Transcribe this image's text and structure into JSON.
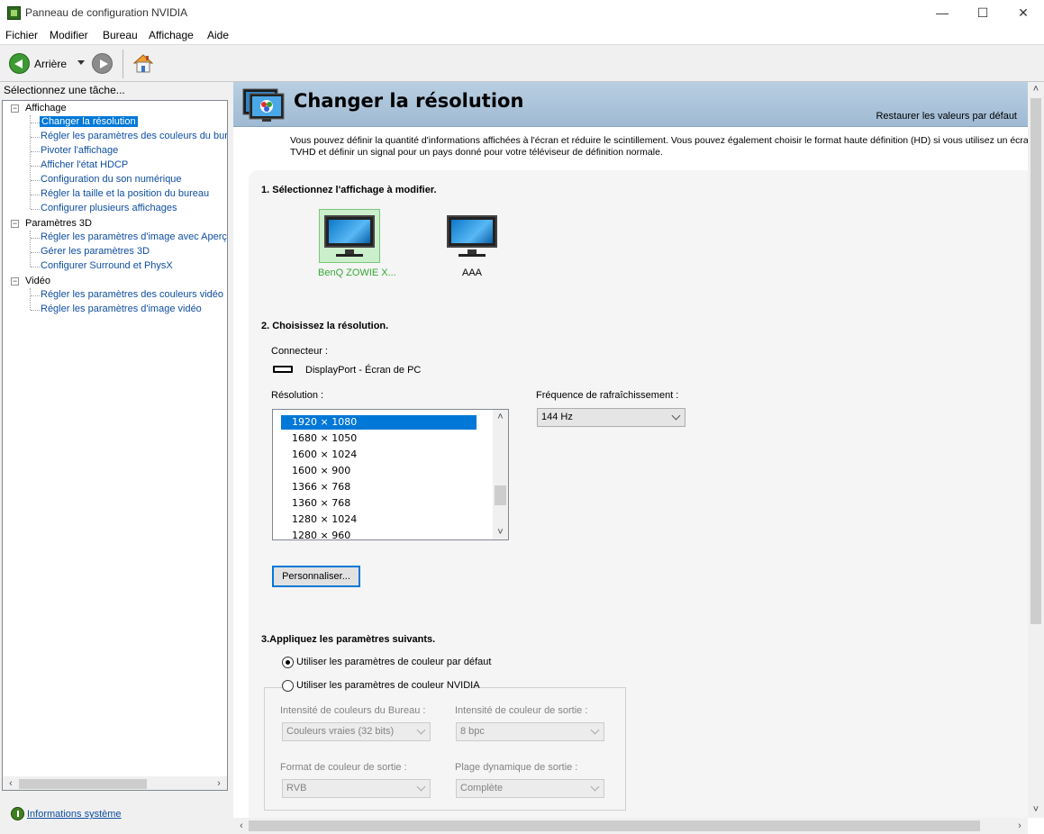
{
  "window": {
    "title": "Panneau de configuration NVIDIA",
    "minimize": "—",
    "maximize": "☐",
    "close": "✕"
  },
  "menu": [
    "Fichier",
    "Modifier",
    "Bureau",
    "Affichage",
    "Aide"
  ],
  "toolbar": {
    "back_label": "Arrière"
  },
  "sidebar": {
    "header": "Sélectionnez une tâche...",
    "groups": [
      {
        "label": "Affichage",
        "expander": "−",
        "items": [
          "Changer la résolution",
          "Régler les paramètres des couleurs du bure",
          "Pivoter l'affichage",
          "Afficher l'état HDCP",
          "Configuration du son numérique",
          "Régler la taille et la position du bureau",
          "Configurer plusieurs affichages"
        ]
      },
      {
        "label": "Paramètres 3D",
        "expander": "−",
        "items": [
          "Régler les paramètres d'image avec Aperçu",
          "Gérer les paramètres 3D",
          "Configurer Surround et PhysX"
        ]
      },
      {
        "label": "Vidéo",
        "expander": "−",
        "items": [
          "Régler les paramètres des couleurs vidéo",
          "Régler les paramètres d'image vidéo"
        ]
      }
    ],
    "selected_item": "Changer la résolution",
    "system_info_link": "Informations système"
  },
  "page": {
    "title": "Changer la résolution",
    "restore_defaults": "Restaurer les valeurs par défaut",
    "intro_line1": "Vous pouvez définir la quantité d'informations affichées à l'écran et réduire le scintillement. Vous pouvez également choisir le format haute définition (HD) si vous utilisez un écra",
    "intro_line2": "TVHD et définir un signal pour un pays donné pour votre téléviseur de définition normale.",
    "section1": {
      "title": "1. Sélectionnez l'affichage à modifier.",
      "displays": [
        {
          "label": "BenQ ZOWIE X...",
          "selected": true
        },
        {
          "label": "AAA",
          "selected": false
        }
      ]
    },
    "section2": {
      "title": "2. Choisissez la résolution.",
      "connector_label": "Connecteur :",
      "connector_value": "DisplayPort - Écran de PC",
      "resolution_label": "Résolution :",
      "resolutions": [
        "1920 × 1080",
        "1680 × 1050",
        "1600 × 1024",
        "1600 × 900",
        "1366 × 768",
        "1360 × 768",
        "1280 × 1024",
        "1280 × 960"
      ],
      "selected_resolution": "1920 × 1080",
      "refresh_label": "Fréquence de rafraîchissement :",
      "refresh_value": "144 Hz",
      "customize_button": "Personnaliser..."
    },
    "section3": {
      "title": "3.Appliquez les paramètres suivants.",
      "radio_default": "Utiliser les paramètres de couleur par défaut",
      "radio_nvidia": "Utiliser les paramètres de couleur NVIDIA",
      "desktop_depth_label": "Intensité de couleurs du Bureau :",
      "desktop_depth_value": "Couleurs vraies (32 bits)",
      "output_depth_label": "Intensité de couleur de sortie :",
      "output_depth_value": "8 bpc",
      "output_format_label": "Format de couleur de sortie :",
      "output_format_value": "RVB",
      "dynamic_range_label": "Plage dynamique de sortie :",
      "dynamic_range_value": "Complète"
    }
  },
  "colors": {
    "nvidia_green": "#76b900",
    "link_blue": "#0f4ea0",
    "selection_blue": "#0078d7",
    "banner": "#a9c3da"
  }
}
